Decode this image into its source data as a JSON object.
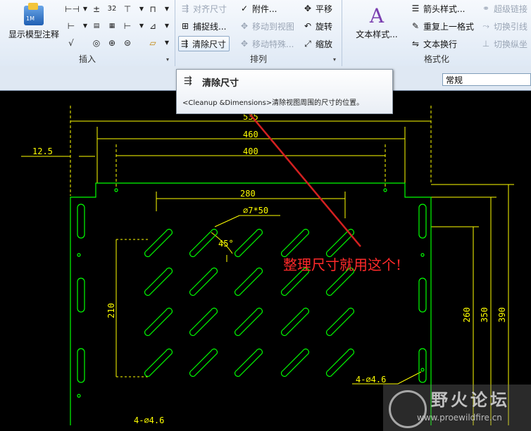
{
  "ribbon": {
    "insert_group": {
      "label": "插入",
      "show_model_annotation": "显示模型注释"
    },
    "arrange_group": {
      "label": "排列",
      "align_dim": "对齐尺寸",
      "attach": "附件...",
      "translate": "平移",
      "snap_line": "捕捉线...",
      "move_to_view": "移动到视图",
      "rotate": "旋转",
      "cleanup_dims": "清除尺寸",
      "move_special": "移动特殊...",
      "scale": "缩放"
    },
    "format_group": {
      "label": "格式化",
      "text_style": "文本样式...",
      "arrow_style": "箭头样式...",
      "repeat_format": "重复上一格式",
      "text_wrap": "文本换行",
      "super_link": "超级链接",
      "toggle_leader": "切换引线",
      "toggle_ordinate": "切换纵坐"
    }
  },
  "style_combo": {
    "value": "常规"
  },
  "tooltip": {
    "title": "清除尺寸",
    "body": "<Cleanup &Dimensions>清除视图周围的尺寸的位置。"
  },
  "drawing": {
    "dims": {
      "d535": "535",
      "d460": "460",
      "d400": "400",
      "d12_5": "12.5",
      "d280": "280",
      "d_hole": "∅7*50",
      "angle": "45°",
      "d210": "210",
      "d260": "260",
      "d350": "350",
      "d390": "390",
      "holes_right": "4-∅4.6",
      "holes_left": "4-∅4.6"
    }
  },
  "annotation": {
    "text": "整理尺寸就用这个!"
  },
  "watermark": {
    "text": "野火论坛",
    "url": "www.proewildfire.cn"
  },
  "colors": {
    "dim": "#ffff00",
    "geometry": "#00ff00",
    "arrow": "#d42020",
    "note": "#ff2a2a"
  }
}
